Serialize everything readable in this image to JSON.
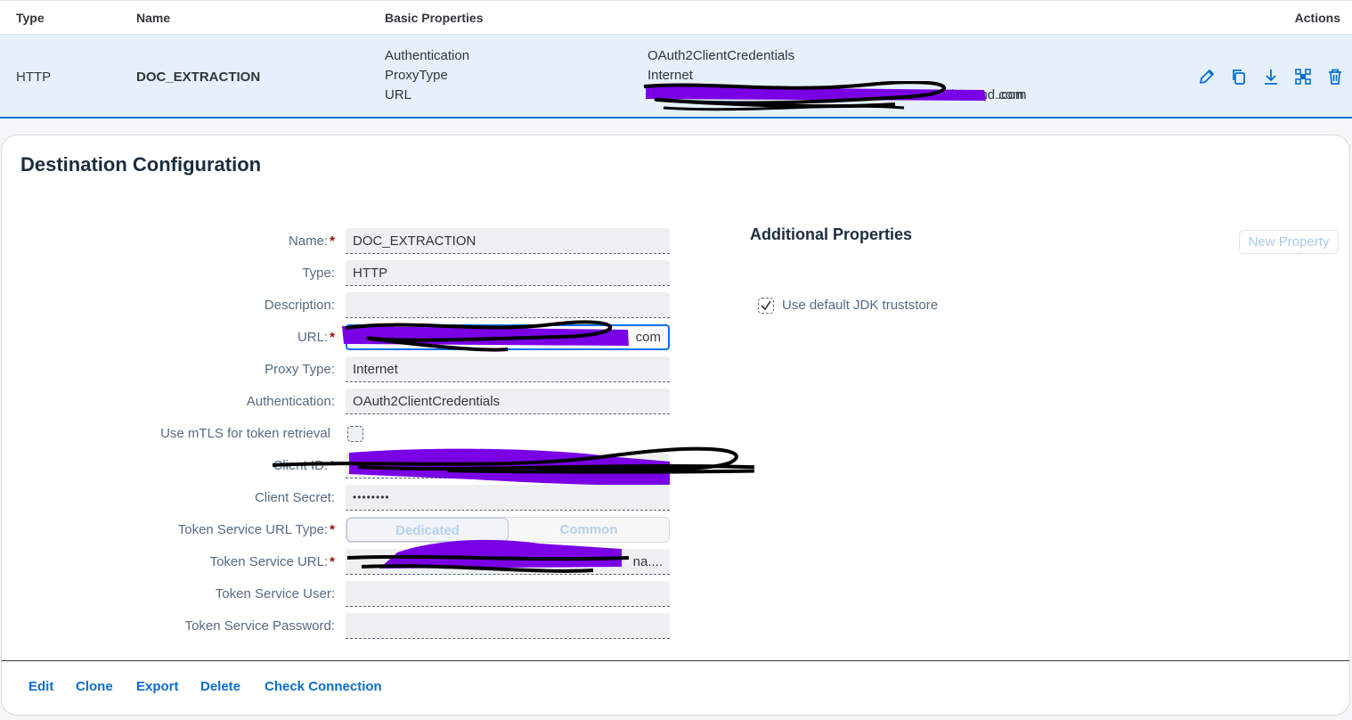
{
  "table": {
    "headers": {
      "type": "Type",
      "name": "Name",
      "basic_properties": "Basic Properties",
      "actions": "Actions"
    },
    "row": {
      "type": "HTTP",
      "name": "DOC_EXTRACTION",
      "properties": [
        {
          "key": "Authentication",
          "value": "OAuth2ClientCredentials"
        },
        {
          "key": "ProxyType",
          "value": "Internet"
        },
        {
          "key": "URL",
          "value": "ana.ondemand.com"
        }
      ],
      "action_icons": [
        "edit-icon",
        "copy-icon",
        "download-icon",
        "network-icon",
        "delete-icon"
      ]
    }
  },
  "panel": {
    "title": "Destination Configuration",
    "fields": {
      "name": {
        "label": "Name:",
        "value": "DOC_EXTRACTION",
        "required": "*"
      },
      "type": {
        "label": "Type:",
        "value": "HTTP"
      },
      "description": {
        "label": "Description:",
        "value": ""
      },
      "url": {
        "label": "URL:",
        "value": "com",
        "required": "*"
      },
      "proxy_type": {
        "label": "Proxy Type:",
        "value": "Internet"
      },
      "authentication": {
        "label": "Authentication:",
        "value": "OAuth2ClientCredentials"
      },
      "mtls": {
        "label": "Use mTLS for token retrieval"
      },
      "client_id": {
        "label": "Client ID:",
        "required": "*"
      },
      "client_secret": {
        "label": "Client Secret:",
        "value": "••••••••"
      },
      "token_url_type": {
        "label": "Token Service URL Type:",
        "required": "*",
        "options": [
          "Dedicated",
          "Common"
        ]
      },
      "token_url": {
        "label": "Token Service URL:",
        "value": "na....",
        "required": "*"
      },
      "token_user": {
        "label": "Token Service User:",
        "value": ""
      },
      "token_password": {
        "label": "Token Service Password:",
        "value": ""
      }
    },
    "additional": {
      "title": "Additional Properties",
      "new_property": "New Property",
      "jdk_truststore": "Use default JDK truststore"
    },
    "footer": {
      "edit": "Edit",
      "clone": "Clone",
      "export": "Export",
      "delete": "Delete",
      "check": "Check Connection"
    }
  },
  "colors": {
    "accent": "#0a6ed1",
    "required": "#aa0808",
    "row_highlight": "#e5f0fa",
    "redaction": "#7a00e6"
  }
}
